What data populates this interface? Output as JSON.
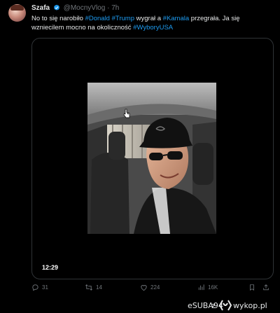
{
  "tweet": {
    "author_name": "Szafa",
    "handle": "@MocnyVlog",
    "separator": "·",
    "time": "7h",
    "text_parts": [
      {
        "t": "No to się narobiło ",
        "tag": false
      },
      {
        "t": "#Donald",
        "tag": true
      },
      {
        "t": " ",
        "tag": false
      },
      {
        "t": "#Trump",
        "tag": true
      },
      {
        "t": " wygrał a ",
        "tag": false
      },
      {
        "t": "#Kamala",
        "tag": true
      },
      {
        "t": " przegrała. Ja się wzniecilem mocno na okoliczność ",
        "tag": false
      },
      {
        "t": "#WyboryUSA",
        "tag": true
      }
    ],
    "hashtag_color": "#1d9bf0",
    "video": {
      "duration": "12:29"
    },
    "actions": {
      "replies": "31",
      "reposts": "14",
      "likes": "224",
      "views": "16K"
    }
  },
  "watermark": {
    "user": "eSUBA94",
    "joiner": "z",
    "site": "wykop.pl"
  }
}
